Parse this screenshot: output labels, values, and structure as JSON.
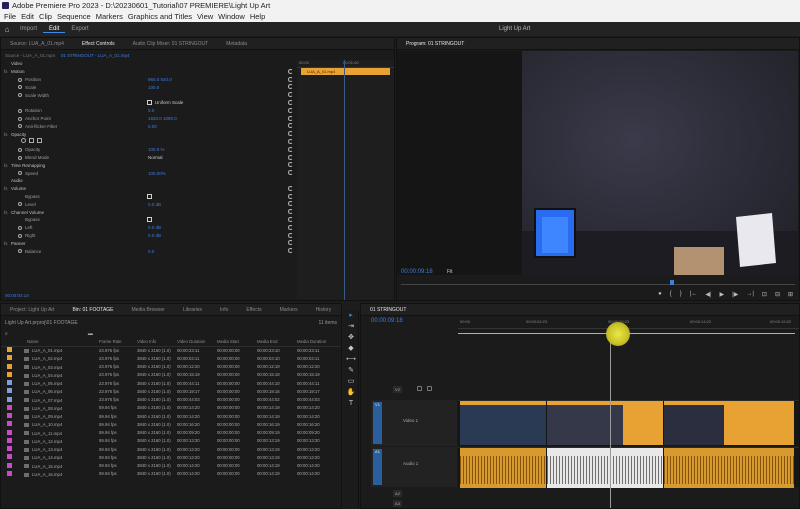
{
  "window": {
    "title": "Adobe Premiere Pro 2023 - D:\\20230601_Tutorial\\07 PREMIERE\\Light Up Art"
  },
  "menu": [
    "File",
    "Edit",
    "Clip",
    "Sequence",
    "Markers",
    "Graphics and Titles",
    "View",
    "Window",
    "Help"
  ],
  "header": {
    "workspaces": [
      "Import",
      "Edit",
      "Export"
    ],
    "active_workspace": "Edit",
    "center_title": "Light Up Art"
  },
  "source_panel": {
    "tabs": [
      "Source: LUA_A_01.mp4",
      "Effect Controls",
      "Audio Clip Mixer: 01 STRINGOUT",
      "Metadata"
    ],
    "active_tab": "Effect Controls",
    "clip_path": [
      "Source - LUA_A_01.mp4",
      "01 STRINGOUT - LUA_A_01.mp4"
    ],
    "ruler_start": "00:00",
    "ruler_end": "00:01:00",
    "clip_label": "LUA_A_01.mp4",
    "rows": [
      {
        "kind": "sec",
        "name": "Video"
      },
      {
        "kind": "sec",
        "fx": "fx",
        "name": "Motion"
      },
      {
        "kind": "prop",
        "name": "Position",
        "value": "960.0   540.0"
      },
      {
        "kind": "prop",
        "name": "Scale",
        "value": "100.0"
      },
      {
        "kind": "prop",
        "name": "Scale Width",
        "value": ""
      },
      {
        "kind": "check",
        "name": "",
        "value": "Uniform Scale"
      },
      {
        "kind": "prop",
        "name": "Rotation",
        "value": "0.0"
      },
      {
        "kind": "prop",
        "name": "Anchor Point",
        "value": "1920.0   1080.0"
      },
      {
        "kind": "prop",
        "name": "Anti-flicker Filter",
        "value": "0.00"
      },
      {
        "kind": "sec",
        "fx": "fx",
        "name": "Opacity"
      },
      {
        "kind": "masks",
        "name": "",
        "value": ""
      },
      {
        "kind": "prop",
        "name": "Opacity",
        "value": "100.0 %"
      },
      {
        "kind": "blend",
        "name": "Blend Mode",
        "value": "Normal"
      },
      {
        "kind": "sec",
        "fx": "fx",
        "name": "Time Remapping"
      },
      {
        "kind": "prop",
        "name": "Speed",
        "value": "100.00%"
      },
      {
        "kind": "sec",
        "name": "Audio"
      },
      {
        "kind": "sec",
        "fx": "fx",
        "name": "Volume"
      },
      {
        "kind": "check",
        "name": "Bypass",
        "value": ""
      },
      {
        "kind": "prop",
        "name": "Level",
        "value": "0.0 dB"
      },
      {
        "kind": "sec",
        "fx": "fx",
        "name": "Channel Volume"
      },
      {
        "kind": "check",
        "name": "Bypass",
        "value": ""
      },
      {
        "kind": "prop",
        "name": "Left",
        "value": "0.0 dB"
      },
      {
        "kind": "prop",
        "name": "Right",
        "value": "0.0 dB"
      },
      {
        "kind": "sec",
        "fx": "fx",
        "name": "Panner"
      },
      {
        "kind": "prop",
        "name": "Balance",
        "value": "0.0"
      }
    ],
    "timecode": "00:00:04:14"
  },
  "program": {
    "tab": "Program: 01 STRINGOUT",
    "timecode": "00:00:09:18",
    "fit": "Fit",
    "controls": [
      "●",
      "{",
      "}",
      "|←",
      "◀|",
      "▶",
      "|▶",
      "→|",
      "⊡",
      "⊟",
      "⊞"
    ]
  },
  "project": {
    "tabs": [
      "Project: Light Up Art",
      "Bin: 01 FOOTAGE",
      "Media Browser",
      "Libraries",
      "Info",
      "Effects",
      "Markers",
      "History"
    ],
    "active_tab": "Bin: 01 FOOTAGE",
    "path": "Light Up Art.prproj\\01 FOOTAGE",
    "count": "11 items",
    "columns": [
      "Name",
      "Frame Rate",
      "Video Info",
      "Video Duration",
      "Media Start",
      "Media End",
      "Media Duration"
    ],
    "rows": [
      {
        "color": "#e8a234",
        "name": "LUA_A_01.mp4",
        "fps": "23.976 fps",
        "info": "3840 x 2160 (1.0)",
        "vdur": "00:00:23:11",
        "start": "00:00:00:00",
        "end": "00:00:23:10",
        "mdur": "00:00:23:11"
      },
      {
        "color": "#e8a234",
        "name": "LUA_A_02.mp4",
        "fps": "23.976 fps",
        "info": "3840 x 2160 (1.0)",
        "vdur": "00:00:04:11",
        "start": "00:00:00:00",
        "end": "00:00:04:10",
        "mdur": "00:00:04:11"
      },
      {
        "color": "#e8a234",
        "name": "LUA_A_03.mp4",
        "fps": "23.976 fps",
        "info": "3840 x 2160 (1.0)",
        "vdur": "00:00:12:20",
        "start": "00:00:00:00",
        "end": "00:00:12:19",
        "mdur": "00:00:12:20"
      },
      {
        "color": "#e8a234",
        "name": "LUA_A_04.mp4",
        "fps": "23.976 fps",
        "info": "3840 x 2160 (1.0)",
        "vdur": "00:00:15:19",
        "start": "00:00:00:00",
        "end": "00:00:15:18",
        "mdur": "00:00:15:19"
      },
      {
        "color": "#7f9fd8",
        "name": "LUA_A_05.mp4",
        "fps": "23.976 fps",
        "info": "3840 x 2160 (1.0)",
        "vdur": "00:00:44:11",
        "start": "00:00:00:00",
        "end": "00:00:44:10",
        "mdur": "00:00:44:11"
      },
      {
        "color": "#7f9fd8",
        "name": "LUA_A_06.mp4",
        "fps": "23.976 fps",
        "info": "3840 x 2160 (1.0)",
        "vdur": "00:00:19:17",
        "start": "00:00:00:00",
        "end": "00:00:19:16",
        "mdur": "00:00:19:17"
      },
      {
        "color": "#7f9fd8",
        "name": "LUA_A_07.mp4",
        "fps": "23.976 fps",
        "info": "3840 x 2160 (1.0)",
        "vdur": "00:00:44:03",
        "start": "00:00:00:00",
        "end": "00:00:44:02",
        "mdur": "00:00:44:03"
      },
      {
        "color": "#c84bc8",
        "name": "LUA_A_08.mp4",
        "fps": "59.94 fps",
        "info": "3840 x 2160 (1.0)",
        "vdur": "00:00:14:20",
        "start": "00:00:00:00",
        "end": "00:00:14:19",
        "mdur": "00:00:14:20"
      },
      {
        "color": "#c84bc8",
        "name": "LUA_A_09.mp4",
        "fps": "59.94 fps",
        "info": "3840 x 2160 (1.0)",
        "vdur": "00:00:14:20",
        "start": "00:00:00:00",
        "end": "00:00:14:19",
        "mdur": "00:00:14:20"
      },
      {
        "color": "#c84bc8",
        "name": "LUA_A_10.mp4",
        "fps": "59.94 fps",
        "info": "3840 x 2160 (1.0)",
        "vdur": "00:00:16:20",
        "start": "00:00:00:00",
        "end": "00:00:16:19",
        "mdur": "00:00:16:20"
      },
      {
        "color": "#c84bc8",
        "name": "LUA_A_11.mp4",
        "fps": "59.94 fps",
        "info": "3840 x 2160 (1.0)",
        "vdur": "00:00:09:20",
        "start": "00:00:00:00",
        "end": "00:00:09:19",
        "mdur": "00:00:09:20"
      },
      {
        "color": "#c84bc8",
        "name": "LUA_A_12.mp4",
        "fps": "59.94 fps",
        "info": "3840 x 2160 (1.0)",
        "vdur": "00:00:13:20",
        "start": "00:00:00:00",
        "end": "00:00:13:19",
        "mdur": "00:00:13:20"
      },
      {
        "color": "#c84bc8",
        "name": "LUA_A_13.mp4",
        "fps": "59.94 fps",
        "info": "3840 x 2160 (1.0)",
        "vdur": "00:00:13:20",
        "start": "00:00:00:00",
        "end": "00:00:13:19",
        "mdur": "00:00:13:20"
      },
      {
        "color": "#c84bc8",
        "name": "LUA_A_14.mp4",
        "fps": "59.94 fps",
        "info": "3840 x 2160 (1.0)",
        "vdur": "00:00:13:20",
        "start": "00:00:00:00",
        "end": "00:00:13:19",
        "mdur": "00:00:13:20"
      },
      {
        "color": "#c84bc8",
        "name": "LUA_A_15.mp4",
        "fps": "59.94 fps",
        "info": "3840 x 2160 (1.0)",
        "vdur": "00:00:14:20",
        "start": "00:00:00:00",
        "end": "00:00:14:19",
        "mdur": "00:00:14:20"
      },
      {
        "color": "#c84bc8",
        "name": "LUA_A_16.mp4",
        "fps": "59.94 fps",
        "info": "3840 x 2160 (1.0)",
        "vdur": "00:00:14:20",
        "start": "00:00:00:00",
        "end": "00:00:14:19",
        "mdur": "00:00:14:20"
      }
    ]
  },
  "tools": [
    "▸",
    "⇥",
    "✥",
    "◆",
    "⟷",
    "✎",
    "▭",
    "✋",
    "T"
  ],
  "timeline": {
    "tab": "01 STRINGOUT",
    "timecode": "00:00:09:18",
    "ruler_labels": [
      "00:00",
      "00:00:04:23",
      "00:00:09:23",
      "00:00:14:22",
      "00:00:19:22"
    ],
    "tracks": {
      "v2": "V2",
      "v1": "V1",
      "video1": "Video 1",
      "a1": "A1",
      "audio1": "Audio 1",
      "a2": "A2",
      "a3": "A3"
    },
    "video_clips": [
      {
        "name": "LUA_A_01.mp4 [V]"
      },
      {
        "name": "LUA_A_03.mp4 [V]"
      },
      {
        "name": "LUA_A_05.mp4 [V]"
      }
    ]
  },
  "colors": {
    "accent": "#3d7ee0",
    "clip_orange": "#e8a234",
    "in_out_bar": "#b8c23a"
  }
}
